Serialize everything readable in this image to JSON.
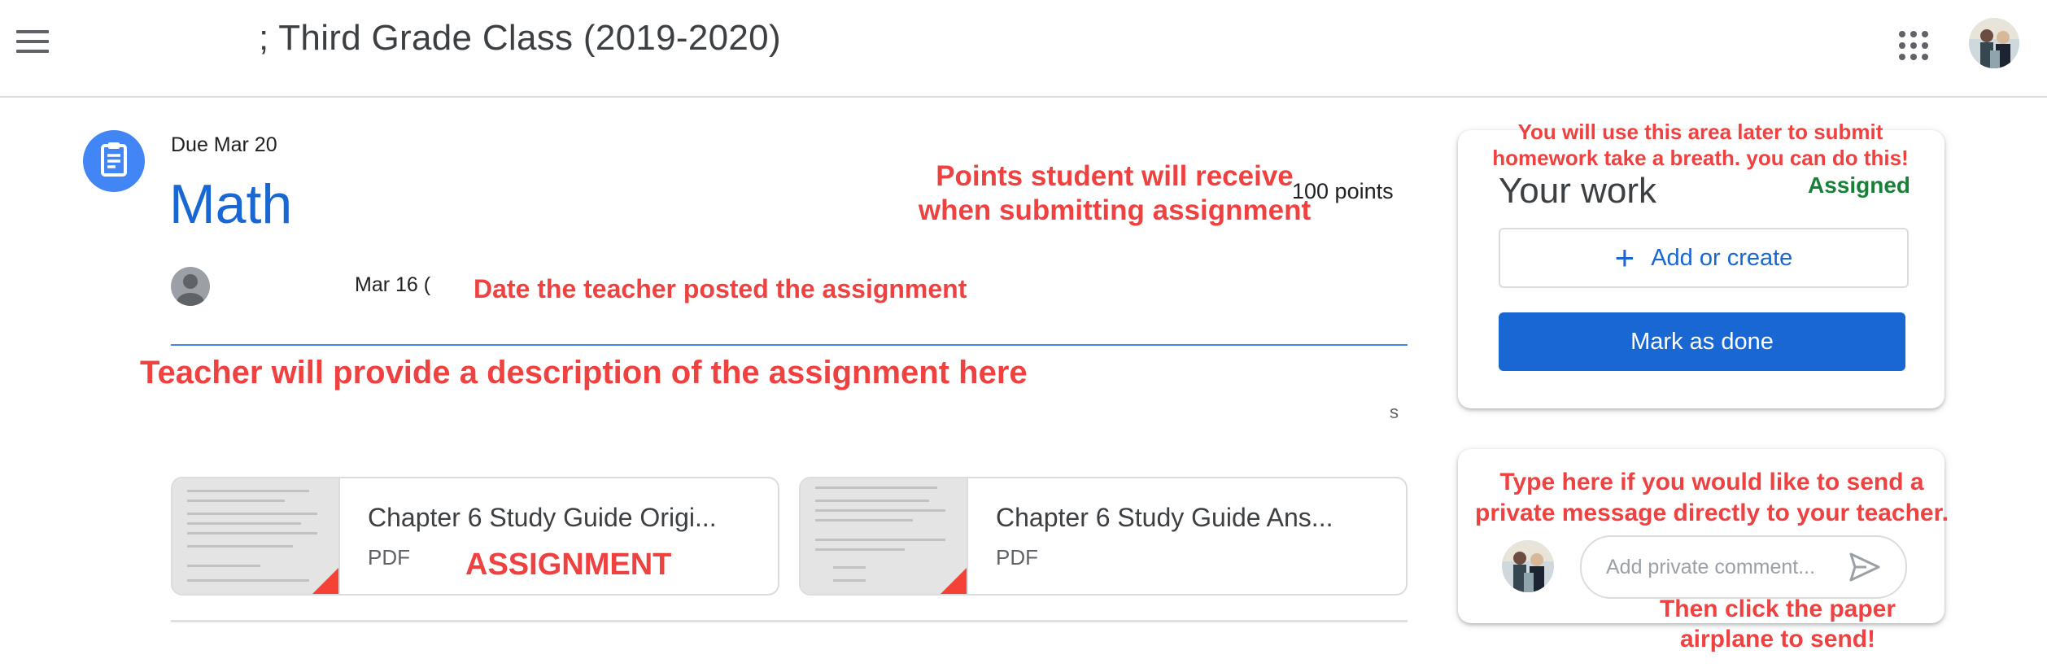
{
  "header": {
    "menu_icon": "hamburger-menu-icon",
    "class_title": "; Third Grade Class (2019-2020)",
    "apps_icon": "apps-grid-icon"
  },
  "assignment": {
    "icon": "assignment-icon",
    "due": "Due Mar 20",
    "title": "Math",
    "points": "100 points",
    "posted_date": "Mar 16 (",
    "stray_text": "s"
  },
  "attachments": [
    {
      "name": "Chapter 6 Study Guide Origi...",
      "type": "PDF"
    },
    {
      "name": "Chapter 6 Study Guide Ans...",
      "type": "PDF"
    }
  ],
  "your_work": {
    "heading": "Your work",
    "status": "Assigned",
    "add_label": "Add or create",
    "mark_done_label": "Mark as done"
  },
  "private_comment": {
    "placeholder": "Add private comment...",
    "send_icon": "send-paper-airplane-icon"
  },
  "annotations": {
    "points_line1": "Points student will receive",
    "points_line2": "when submitting assignment",
    "date_posted": "Date the teacher posted the assignment",
    "description": "Teacher will provide a description of the assignment here",
    "assignment": "ASSIGNMENT",
    "submit_line1": "You will use this area later to submit",
    "submit_line2": "homework take a breath. you can do this!",
    "private_line1": "Type here if you would like to send a",
    "private_line2": "private message directly to your teacher.",
    "send_line1": "Then click the paper",
    "send_line2": "airplane to send!"
  },
  "colors": {
    "accent_blue": "#1967d2",
    "icon_blue": "#4285f4",
    "assigned_green": "#188038",
    "annotation_red": "#f04141",
    "pdf_red": "#f44336"
  }
}
